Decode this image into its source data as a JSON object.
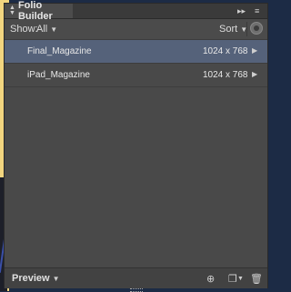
{
  "panel": {
    "title": "Folio Builder",
    "title_controls": {
      "collapse": "▸▸",
      "menu": "≡"
    }
  },
  "toolbar": {
    "show_label": "Show:",
    "show_value": "All",
    "sort_label": "Sort"
  },
  "folios": [
    {
      "name": "Final_Magazine",
      "size": "1024 x 768",
      "selected": true
    },
    {
      "name": "iPad_Magazine",
      "size": "1024 x 768",
      "selected": false
    }
  ],
  "footer": {
    "preview_label": "Preview"
  }
}
